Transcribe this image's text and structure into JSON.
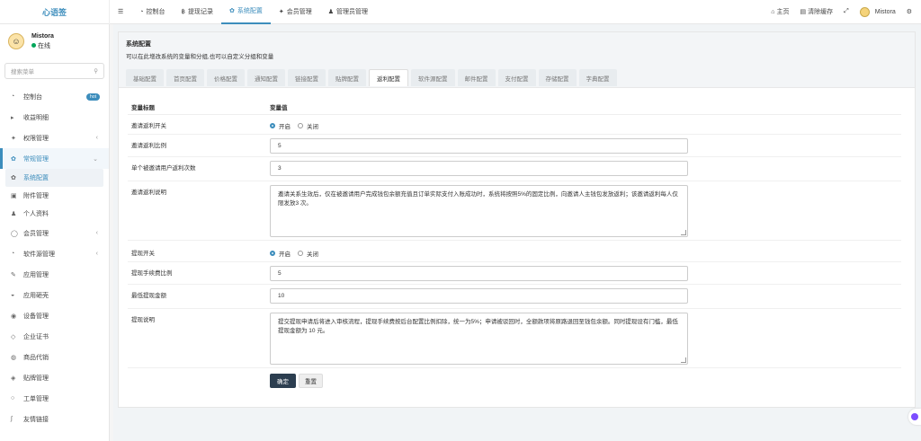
{
  "brand": "心语签",
  "topnav": [
    {
      "icon": "☰",
      "label": ""
    },
    {
      "icon": "◔",
      "label": "控制台"
    },
    {
      "icon": "฿",
      "label": "提现记录"
    },
    {
      "icon": "✿",
      "label": "系统配置"
    },
    {
      "icon": "✦",
      "label": "会员管理"
    },
    {
      "icon": "♟",
      "label": "管理员管理"
    }
  ],
  "topright": {
    "home": "主页",
    "clear_cache": "清除缓存",
    "user": "Mistora"
  },
  "user": {
    "name": "Mistora",
    "status": "在线"
  },
  "sidebar": {
    "search_placeholder": "搜索菜单",
    "items": [
      {
        "label": "控制台",
        "icon": "◔",
        "badge": "hot"
      },
      {
        "label": "收益明细",
        "icon": "▸"
      },
      {
        "label": "权限管理",
        "icon": "✦",
        "arrow": "‹"
      },
      {
        "label": "常规管理",
        "icon": "✿",
        "arrow": "⌄"
      },
      {
        "label": "会员管理",
        "icon": "◯",
        "arrow": "‹"
      },
      {
        "label": "软件源管理",
        "icon": "◔",
        "arrow": "‹"
      },
      {
        "label": "应用管理",
        "icon": "✎"
      },
      {
        "label": "应用砸壳",
        "icon": "◒"
      },
      {
        "label": "设备管理",
        "icon": "◉"
      },
      {
        "label": "企业证书",
        "icon": "◇"
      },
      {
        "label": "商品代销",
        "icon": "◍"
      },
      {
        "label": "贴牌管理",
        "icon": "◈"
      },
      {
        "label": "工单管理",
        "icon": "○"
      },
      {
        "label": "友情链接",
        "icon": "∫"
      }
    ],
    "sub_items": [
      {
        "label": "系统配置",
        "icon": "✿"
      },
      {
        "label": "附件管理",
        "icon": "▣"
      },
      {
        "label": "个人资料",
        "icon": "♟"
      }
    ]
  },
  "panel": {
    "title": "系统配置",
    "desc": "可以在此增改系统的变量和分组,也可以自定义分组和变量",
    "tabs": [
      "基础配置",
      "首页配置",
      "价格配置",
      "通知配置",
      "链接配置",
      "贴牌配置",
      "返利配置",
      "软件源配置",
      "邮件配置",
      "支付配置",
      "存储配置",
      "字典配置"
    ],
    "active_tab": "返利配置",
    "col_title": "变量标题",
    "col_value": "变量值"
  },
  "form": {
    "invite_switch_label": "邀请返利开关",
    "radio_on": "开启",
    "radio_off": "关闭",
    "invite_ratio_label": "邀请返利比例",
    "invite_ratio_value": "5",
    "invite_times_label": "单个被邀请用户返利次数",
    "invite_times_value": "3",
    "invite_desc_label": "邀请返利说明",
    "invite_desc_value": "邀请关系生效后，仅在被邀请用户完成钱包余额充值且订单实际支付入账成功时，系统将按照5%的固定比例，向邀请人主钱包发放返利；该邀请返利每人仅限发放3 次。",
    "withdraw_switch_label": "提现开关",
    "withdraw_fee_label": "提现手续费比例",
    "withdraw_fee_value": "5",
    "withdraw_min_label": "最低提现金额",
    "withdraw_min_value": "10",
    "withdraw_desc_label": "提现说明",
    "withdraw_desc_value": "提交提现申请后将进入审核流程，提现手续费按后台配置比例扣除，统一为5%；申请被驳回时，全额款项将原路退回至钱包余额。同时提现设有门槛，最低提现金额为 10 元。",
    "submit": "确定",
    "reset": "重置"
  }
}
